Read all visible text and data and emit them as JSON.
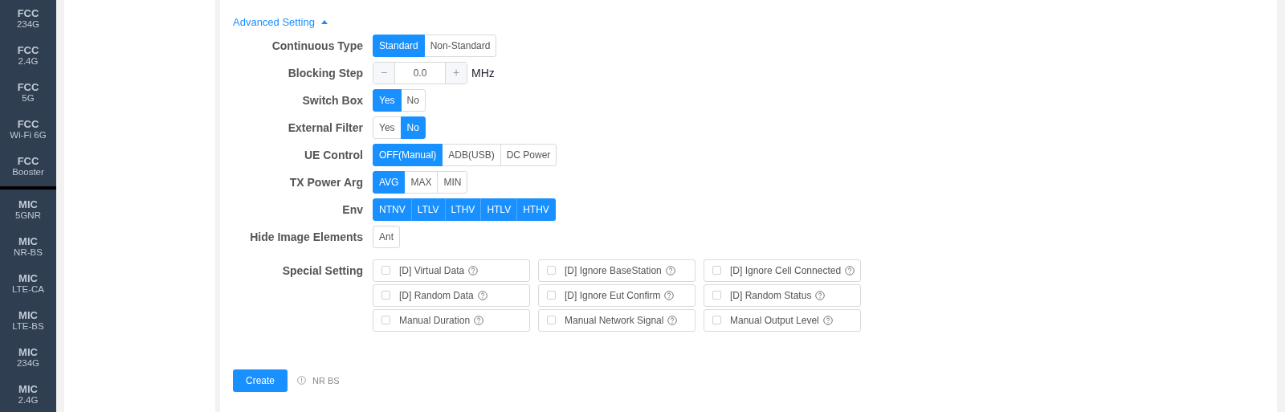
{
  "sidebar": {
    "groups": [
      {
        "items": [
          {
            "top": "FCC",
            "bottom": "234G"
          },
          {
            "top": "FCC",
            "bottom": "2.4G"
          },
          {
            "top": "FCC",
            "bottom": "5G"
          },
          {
            "top": "FCC",
            "bottom": "Wi-Fi 6G"
          },
          {
            "top": "FCC",
            "bottom": "Booster"
          }
        ]
      },
      {
        "items": [
          {
            "top": "MIC",
            "bottom": "5GNR"
          },
          {
            "top": "MIC",
            "bottom": "NR-BS"
          },
          {
            "top": "MIC",
            "bottom": "LTE-CA"
          },
          {
            "top": "MIC",
            "bottom": "LTE-BS"
          },
          {
            "top": "MIC",
            "bottom": "234G"
          },
          {
            "top": "MIC",
            "bottom": "2.4G"
          }
        ]
      }
    ]
  },
  "advanced": {
    "label": "Advanced Setting",
    "expanded": true
  },
  "settings": [
    {
      "label": "Continuous Type",
      "kind": "segmented",
      "options": [
        {
          "label": "Standard",
          "selected": true
        },
        {
          "label": "Non-Standard",
          "selected": false
        }
      ]
    },
    {
      "label": "Blocking Step",
      "kind": "stepper",
      "minus": "−",
      "value": "0.0",
      "plus": "+",
      "unit": "MHz"
    },
    {
      "label": "Switch Box",
      "kind": "segmented",
      "options": [
        {
          "label": "Yes",
          "selected": true
        },
        {
          "label": "No",
          "selected": false
        }
      ]
    },
    {
      "label": "External Filter",
      "kind": "segmented",
      "options": [
        {
          "label": "Yes",
          "selected": false
        },
        {
          "label": "No",
          "selected": true
        }
      ]
    },
    {
      "label": "UE Control",
      "kind": "segmented",
      "options": [
        {
          "label": "OFF(Manual)",
          "selected": true
        },
        {
          "label": "ADB(USB)",
          "selected": false
        },
        {
          "label": "DC Power",
          "selected": false
        }
      ]
    },
    {
      "label": "TX Power Arg",
      "kind": "segmented",
      "options": [
        {
          "label": "AVG",
          "selected": true
        },
        {
          "label": "MAX",
          "selected": false
        },
        {
          "label": "MIN",
          "selected": false
        }
      ]
    },
    {
      "label": "Env",
      "kind": "segmented",
      "options": [
        {
          "label": "NTNV",
          "selected": true
        },
        {
          "label": "LTLV",
          "selected": true
        },
        {
          "label": "LTHV",
          "selected": true
        },
        {
          "label": "HTLV",
          "selected": true
        },
        {
          "label": "HTHV",
          "selected": true
        }
      ]
    },
    {
      "label": "Hide Image Elements",
      "kind": "segmented",
      "options": [
        {
          "label": "Ant",
          "selected": false
        }
      ]
    },
    {
      "label": "Special Setting",
      "kind": "checkgrid",
      "options": [
        {
          "label": "[D] Virtual Data",
          "checked": false
        },
        {
          "label": "[D] Ignore BaseStation",
          "checked": false
        },
        {
          "label": "[D] Ignore Cell Connected",
          "checked": false
        },
        {
          "label": "[D] Random Data",
          "checked": false
        },
        {
          "label": "[D] Ignore Eut Confirm",
          "checked": false
        },
        {
          "label": "[D] Random Status",
          "checked": false
        },
        {
          "label": "Manual Duration",
          "checked": false
        },
        {
          "label": "Manual Network Signal",
          "checked": false
        },
        {
          "label": "Manual Output Level",
          "checked": false
        }
      ]
    }
  ],
  "create_button": "Create",
  "note": "NR BS"
}
